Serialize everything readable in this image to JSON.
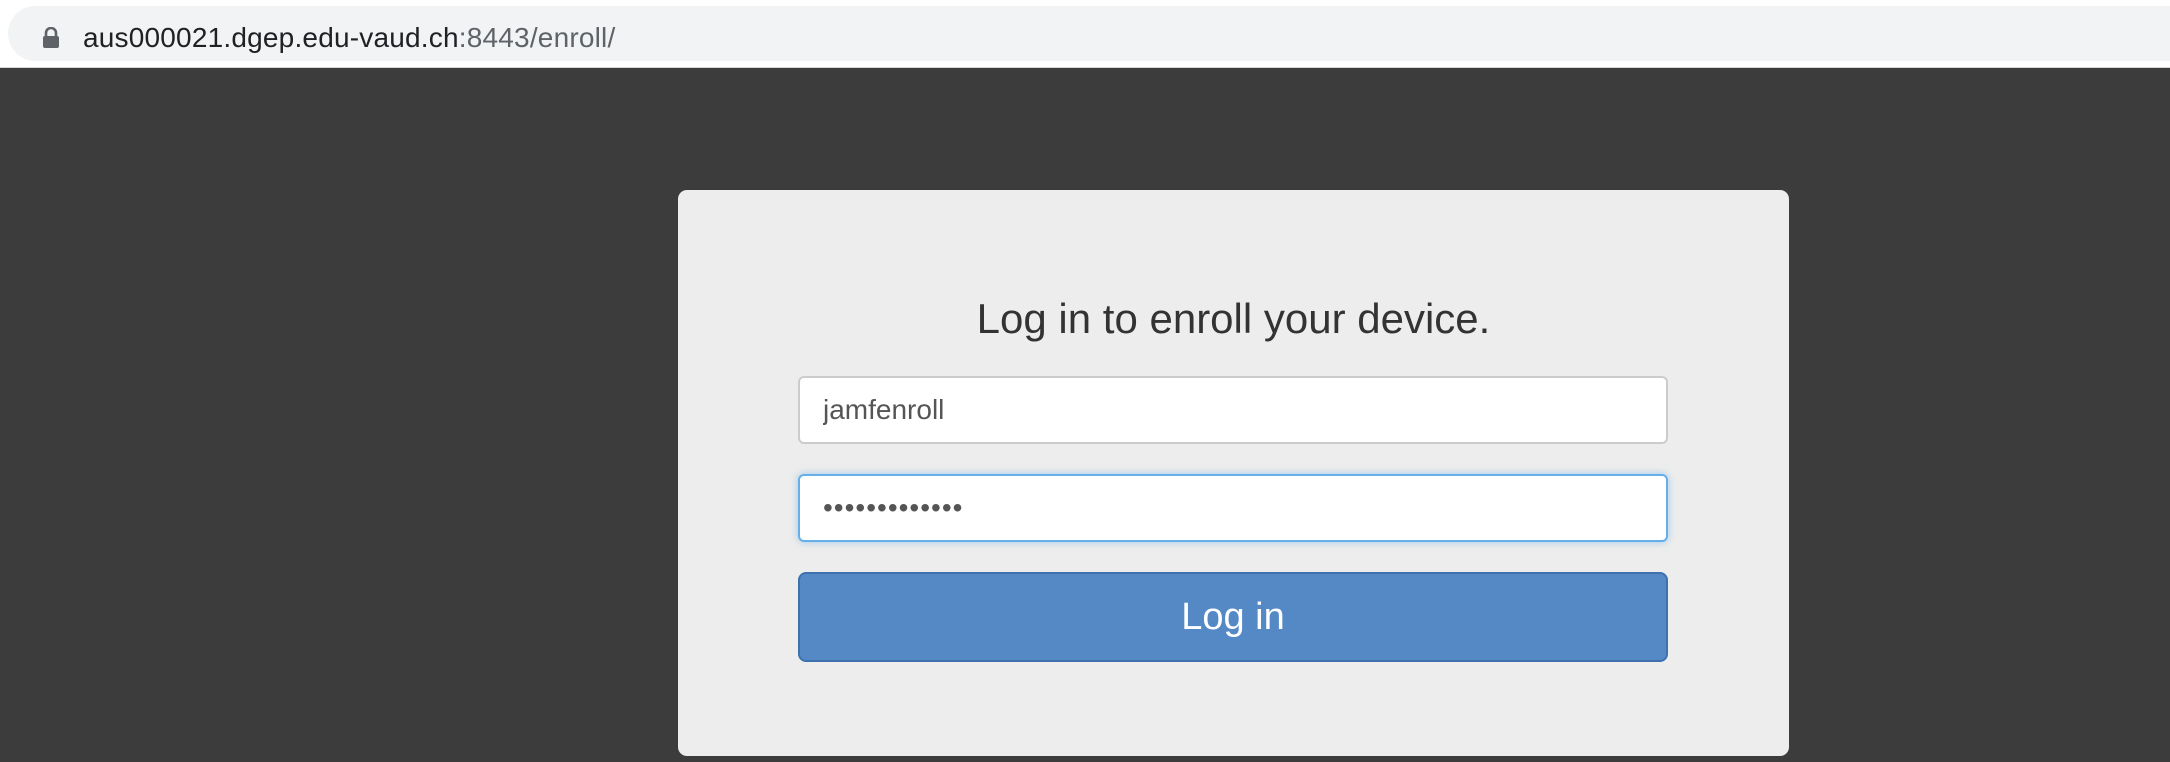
{
  "browser": {
    "url_host": "aus000021.dgep.edu-vaud.ch",
    "url_rest": ":8443/enroll/",
    "lock_icon": "lock-icon"
  },
  "enroll_card": {
    "title": "Log in to enroll your device.",
    "username_value": "jamfenroll",
    "password_value": "•••••••••••••",
    "login_button_label": "Log in"
  },
  "colors": {
    "page_background": "#3c3c3c",
    "card_background": "#ededed",
    "button_primary": "#5589c6",
    "focus_border": "#66afe9"
  }
}
